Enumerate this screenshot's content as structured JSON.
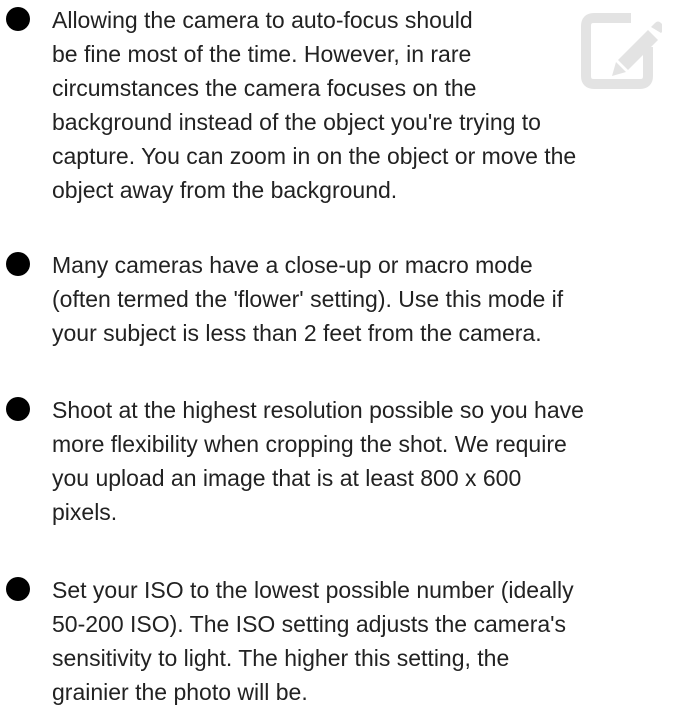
{
  "tips": [
    {
      "lines": [
        "Allowing the camera to auto-focus should",
        "be fine most of the time. However, in rare",
        "circumstances the camera focuses on the",
        "background instead of the object you're trying to",
        "capture. You can zoom in on the object or move the",
        "object away from the background."
      ]
    },
    {
      "lines": [
        "Many cameras have a close-up or macro mode",
        "(often termed the 'flower' setting). Use this mode if",
        "your subject is less than 2 feet from the camera."
      ]
    },
    {
      "lines": [
        "Shoot at the highest resolution possible so you have",
        "more flexibility when cropping the shot. We require",
        "you upload an image that is at least 800 x 600",
        "pixels."
      ]
    },
    {
      "lines": [
        "Set your ISO to the lowest possible number (ideally",
        "50-200 ISO). The ISO setting adjusts the camera's",
        "sensitivity to light. The higher this setting, the",
        "grainier the photo will be."
      ]
    }
  ],
  "icons": {
    "edit": "edit-icon",
    "bullet": "bullet-icon"
  },
  "colors": {
    "text": "#222222",
    "bullet": "#000000",
    "icon": "#e3e3e3"
  }
}
